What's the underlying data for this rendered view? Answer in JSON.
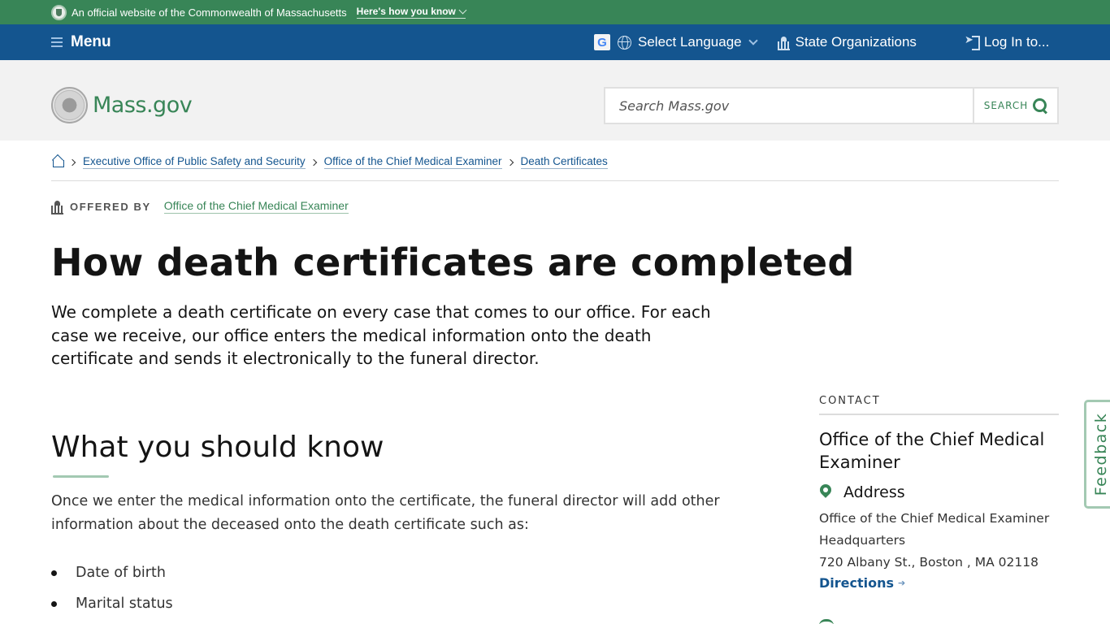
{
  "banner": {
    "official_text": "An official website of the Commonwealth of Massachusetts",
    "how_you_know": "Here's how you know"
  },
  "nav": {
    "menu_label": "Menu",
    "google_icon_glyph": "G",
    "language_label": "Select Language",
    "state_orgs_label": "State Organizations",
    "login_label": "Log In to..."
  },
  "header": {
    "logo_text": "Mass.gov",
    "search_placeholder": "Search Mass.gov",
    "search_button_label": "SEARCH"
  },
  "breadcrumb": [
    {
      "label": "Executive Office of Public Safety and Security"
    },
    {
      "label": "Office of the Chief Medical Examiner"
    },
    {
      "label": "Death Certificates"
    }
  ],
  "offered_by": {
    "label": "OFFERED BY",
    "org": "Office of the Chief Medical Examiner"
  },
  "page": {
    "title": "How death certificates are completed",
    "lede": "We complete a death certificate on every case that comes to our office. For each case we receive, our office enters the medical information onto the death certificate and sends it electronically to the funeral director.",
    "section_title": "What you should know",
    "section_body": "Once we enter the medical information onto the certificate, the funeral director will add other information about the deceased onto the death certificate such as:",
    "bullets": [
      "Date of birth",
      "Marital status"
    ]
  },
  "contact": {
    "label": "CONTACT",
    "org_name": "Office of the Chief Medical Examiner",
    "address_heading": "Address",
    "address_lines": [
      "Office of the Chief Medical Examiner",
      "Headquarters",
      "720 Albany St., Boston , MA 02118"
    ],
    "directions_label": "Directions",
    "directions_arrow": "➔"
  },
  "feedback_label": "Feedback",
  "colors": {
    "banner_green": "#388557",
    "nav_blue": "#14558f",
    "header_gray": "#f2f2f2",
    "link_blue": "#14558f",
    "accent_green": "#388557"
  }
}
